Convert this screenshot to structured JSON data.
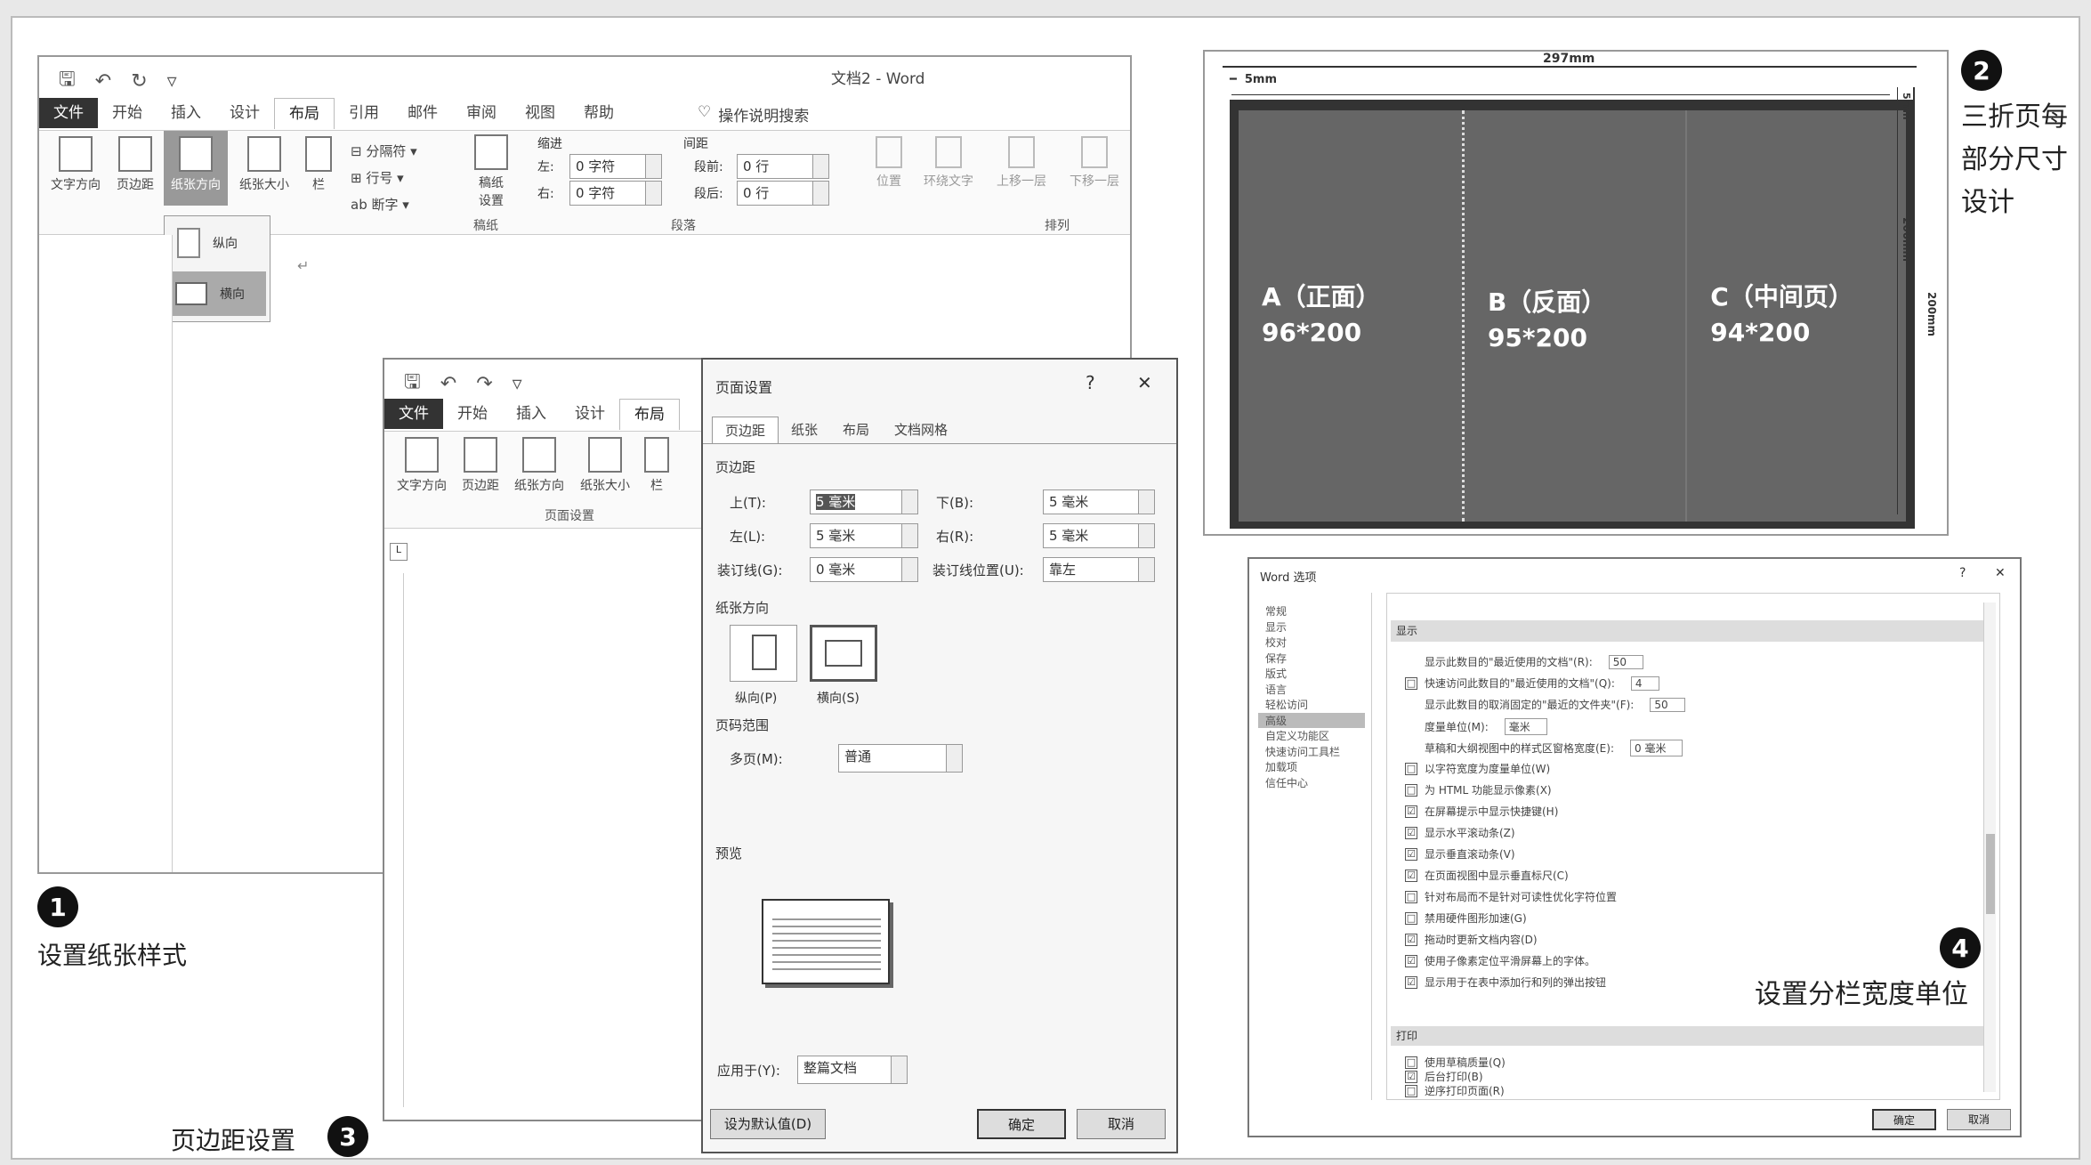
{
  "word1": {
    "title": "文档2 - Word",
    "tabs": [
      "文件",
      "开始",
      "插入",
      "设计",
      "布局",
      "引用",
      "邮件",
      "审阅",
      "视图",
      "帮助"
    ],
    "tell_me": "操作说明搜索",
    "buttons": [
      "文字方向",
      "页边距",
      "纸张方向",
      "纸张大小",
      "栏"
    ],
    "breaks": [
      "分隔符",
      "行号",
      "断字"
    ],
    "draft_button": "稿纸设置",
    "draft_group": "稿纸",
    "indent_title": "缩进",
    "spacing_title": "间距",
    "indent_left_label": "左:",
    "indent_left_value": "0 字符",
    "indent_right_label": "右:",
    "indent_right_value": "0 字符",
    "spacing_before_label": "段前:",
    "spacing_before_value": "0 行",
    "spacing_after_label": "段后:",
    "spacing_after_value": "0 行",
    "paragraph_group": "段落",
    "arrange_buttons": [
      "位置",
      "环绕文字",
      "上移一层",
      "下移一层"
    ],
    "arrange_group": "排列",
    "orient_menu": [
      "纵向",
      "横向"
    ]
  },
  "word2": {
    "tabs": [
      "文件",
      "开始",
      "插入",
      "设计",
      "布局"
    ],
    "buttons": [
      "文字方向",
      "页边距",
      "纸张方向",
      "纸张大小",
      "栏"
    ],
    "group": "页面设置"
  },
  "dialog": {
    "title": "页面设置",
    "help": "?",
    "close": "✕",
    "tabs": [
      "页边距",
      "纸张",
      "布局",
      "文档网格"
    ],
    "margins_section": "页边距",
    "top_label": "上(T):",
    "top_value": "5 毫米",
    "bottom_label": "下(B):",
    "bottom_value": "5 毫米",
    "left_label": "左(L):",
    "left_value": "5 毫米",
    "right_label": "右(R):",
    "right_value": "5 毫米",
    "gutter_label": "装订线(G):",
    "gutter_value": "0 毫米",
    "gutter_pos_label": "装订线位置(U):",
    "gutter_pos_value": "靠左",
    "orient_section": "纸张方向",
    "portrait": "纵向(P)",
    "landscape": "横向(S)",
    "pages_section": "页码范围",
    "multi_label": "多页(M):",
    "multi_value": "普通",
    "preview_section": "预览",
    "apply_label": "应用于(Y):",
    "apply_value": "整篇文档",
    "default_btn": "设为默认值(D)",
    "ok": "确定",
    "cancel": "取消"
  },
  "diagram": {
    "total_width": "297mm",
    "margin": "5mm",
    "height": "200mm",
    "margin_side": "5mm",
    "panels": [
      {
        "title": "A（正面）",
        "size": "96*200"
      },
      {
        "title": "B（反面）",
        "size": "95*200"
      },
      {
        "title": "C（中间页）",
        "size": "94*200"
      }
    ]
  },
  "options": {
    "title": "Word 选项",
    "help": "?",
    "close": "✕",
    "nav": [
      "常规",
      "显示",
      "校对",
      "保存",
      "版式",
      "语言",
      "轻松访问",
      "高级",
      "自定义功能区",
      "快速访问工具栏",
      "加载项",
      "信任中心"
    ],
    "active_nav": "高级",
    "section_display": "显示",
    "section_print": "打印",
    "rows": [
      {
        "check": "",
        "text": "显示此数目的\"最近使用的文档\"(R):",
        "value": "50"
      },
      {
        "check": "□",
        "text": "快速访问此数目的\"最近使用的文档\"(Q):",
        "value": "4"
      },
      {
        "check": "",
        "text": "显示此数目的取消固定的\"最近的文件夹\"(F):",
        "value": "50"
      },
      {
        "check": "",
        "text": "度量单位(M):",
        "value": "毫米"
      },
      {
        "check": "",
        "text": "草稿和大纲视图中的样式区窗格宽度(E):",
        "value": "0 毫米"
      },
      {
        "check": "□",
        "text": "以字符宽度为度量单位(W)",
        "value": ""
      },
      {
        "check": "□",
        "text": "为 HTML 功能显示像素(X)",
        "value": ""
      },
      {
        "check": "☑",
        "text": "在屏幕提示中显示快捷键(H)",
        "value": ""
      },
      {
        "check": "☑",
        "text": "显示水平滚动条(Z)",
        "value": ""
      },
      {
        "check": "☑",
        "text": "显示垂直滚动条(V)",
        "value": ""
      },
      {
        "check": "☑",
        "text": "在页面视图中显示垂直标尺(C)",
        "value": ""
      },
      {
        "check": "□",
        "text": "针对布局而不是针对可读性优化字符位置",
        "value": ""
      },
      {
        "check": "□",
        "text": "禁用硬件图形加速(G)",
        "value": ""
      },
      {
        "check": "☑",
        "text": "拖动时更新文档内容(D)",
        "value": ""
      },
      {
        "check": "☑",
        "text": "使用子像素定位平滑屏幕上的字体。",
        "value": ""
      },
      {
        "check": "☑",
        "text": "显示用于在表中添加行和列的弹出按钮",
        "value": ""
      }
    ],
    "print_rows": [
      {
        "check": "□",
        "text": "使用草稿质量(Q)"
      },
      {
        "check": "☑",
        "text": "后台打印(B)"
      },
      {
        "check": "□",
        "text": "逆序打印页面(R)"
      }
    ],
    "ok": "确定",
    "cancel": "取消"
  },
  "captions": {
    "c1_num": "1",
    "c1": "设置纸张样式",
    "c2_num": "2",
    "c2": "三折页每部分尺寸设计",
    "c3_num": "3",
    "c3": "页边距设置",
    "c4_num": "4",
    "c4": "设置分栏宽度单位"
  }
}
